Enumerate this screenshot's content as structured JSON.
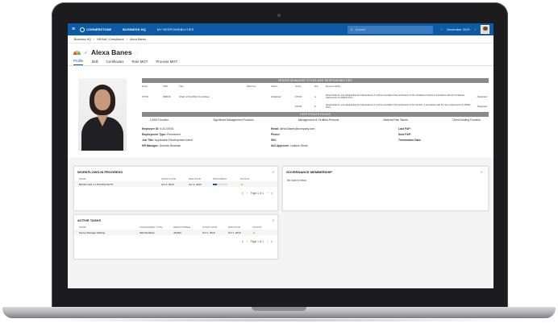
{
  "topbar": {
    "brand": "CORNERSTONE",
    "nav": [
      "BUSINESS HQ",
      "MY RESPONSIBILITIES"
    ],
    "search_placeholder": "Search",
    "prev_arrow": "‹",
    "next_arrow": "›",
    "date": "December 2019"
  },
  "breadcrumb": [
    "Business HQ",
    "HR/AAC Compliance",
    "Alexa Banes"
  ],
  "profile": {
    "name": "Alexa Banes",
    "tabs": [
      "Profile",
      "Skill",
      "Certificates",
      "Role MGT",
      "Process MGT"
    ],
    "active_tab": "Profile"
  },
  "responsibilities": {
    "title": "SENIOR MANAGER TITLES AND RESPONSIBILITIES",
    "headers": [
      "Entity",
      "SMF",
      "Title",
      "Effective",
      "Status",
      "Entity",
      "Ref",
      "Responsibility",
      ""
    ],
    "rows": [
      [
        "FTOO",
        "SMF16",
        "Chair of the Risk Committee",
        "",
        "Assigned",
        "FTOO",
        "a",
        "Responsible for, and safeguarding the independence of, and the oversight of the performance of the compliance function in accordance with the compliance requirements for SMCR Firms.",
        "Assigned"
      ],
      [
        "",
        "",
        "",
        "",
        "",
        "FTOO",
        "b",
        "Responsible for, and safeguarding the independence of, and the oversight of the performance of the function, in accordance with the rules requirements for SMCR Firms.",
        "Assigned"
      ]
    ]
  },
  "certificates": {
    "title": "CERTIFICATE ROLES",
    "items": [
      "CASS Function",
      "Significant Management Function",
      "Management of Certified Persons",
      "Material Risk Takers",
      "Client Dealing Function"
    ]
  },
  "employee": {
    "col1": [
      {
        "label": "Employee ID:",
        "value": "6-41-00031"
      },
      {
        "label": "Employment Type:",
        "value": "Permanent"
      },
      {
        "label": "Job Title:",
        "value": "Application Development Intern"
      },
      {
        "label": "HR Manager:",
        "value": "Dominic Bowman"
      }
    ],
    "col2": [
      {
        "label": "Email:",
        "value": "Alexa.Banes@company.com"
      },
      {
        "label": "Phone:",
        "value": ""
      },
      {
        "label": "SIN:",
        "value": ""
      },
      {
        "label": "IAG Approver:",
        "value": "Ladison Stone"
      }
    ],
    "col3": [
      {
        "label": "Last F&P:",
        "value": ""
      },
      {
        "label": "Next F&P:",
        "value": ""
      },
      {
        "label": "Termination Date:",
        "value": ""
      }
    ]
  },
  "workflows": {
    "title": "WORKFLOWS IN PROGRESS",
    "headers": [
      "NAME",
      "START DATE",
      "END DATE",
      "PROGRESS",
      "STATUS"
    ],
    "rows": [
      {
        "name": "BOOD CHG 1.1 ROUTE DIVTS",
        "start": "Oct 3, 2019",
        "end": "Jun 3, 2023",
        "progress": 0.3,
        "status": "warning"
      }
    ],
    "pager": "Page 1 of 1"
  },
  "tasks": {
    "title": "ACTIVE TASKS",
    "headers": [
      "NAME",
      "ASSIGNMENT TYPE",
      "RESPONSIBLE",
      "START DATE",
      "END DATE",
      "STATUS"
    ],
    "rows": [
      {
        "name": "Senior Manager Waiting",
        "type": "Skill Workflow",
        "responsible": "JANES",
        "start": "Oct 1, 2019",
        "end": "Oct 7, 2019",
        "status": "warning"
      }
    ],
    "pager": "Page 1 of 1"
  },
  "governance": {
    "title": "GOVERNANCE MEMBERSHIP",
    "empty_text": "No rows to show."
  },
  "colors": {
    "brand_blue": "#0d5aa7",
    "warning": "#e8a800"
  }
}
